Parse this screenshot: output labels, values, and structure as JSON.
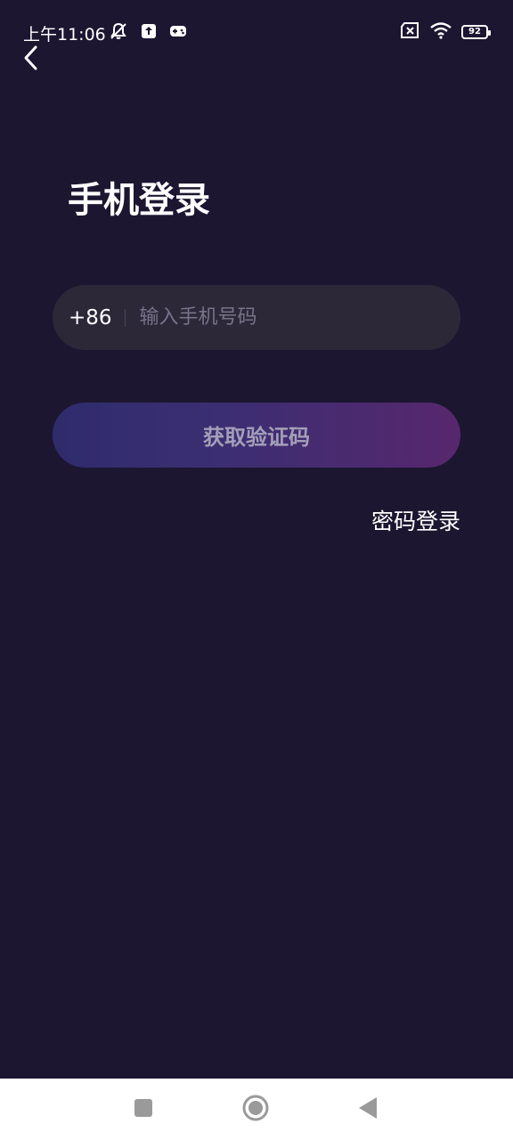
{
  "status_bar": {
    "time": "上午11:06",
    "battery_level": "92",
    "left_icons": [
      "bell-off-icon",
      "upload-icon",
      "gamepad-icon"
    ],
    "right_icons": [
      "sim-off-icon",
      "wifi-icon",
      "battery-icon"
    ]
  },
  "header": {
    "back_icon": "chevron-left-icon"
  },
  "main": {
    "title": "手机登录",
    "phone": {
      "country_code": "+86",
      "placeholder": "输入手机号码",
      "value": ""
    },
    "get_code_label": "获取验证码",
    "password_login_label": "密码登录"
  },
  "navigation_bar": {
    "items": [
      "recent-apps-icon",
      "home-icon",
      "back-icon"
    ]
  },
  "colors": {
    "background": "#1c1631",
    "input_background": "#2c2838",
    "button_gradient_start": "#2f2c6c",
    "button_gradient_end": "#57276d",
    "button_text": "#a39fb8",
    "placeholder": "#77738a"
  }
}
